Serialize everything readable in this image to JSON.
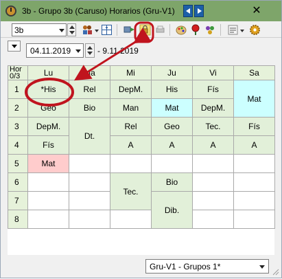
{
  "window": {
    "title": "3b - Grupo 3b (Caruso)  Horarios  (Gru-V1)",
    "close_glyph": "✕"
  },
  "toolbar": {
    "class_value": "3b",
    "icons": [
      "teachers-icon",
      "grid-icon",
      "transfer-icon",
      "lock-icon",
      "print-icon",
      "paint-icon",
      "pin-icon",
      "people-icon",
      "settings-icon",
      "gear-icon"
    ]
  },
  "datebar": {
    "start_date": "04.11.2019",
    "end_date": "- 9.11.2019"
  },
  "timetable": {
    "corner_top": "Hor",
    "corner_bottom": "0/3",
    "days": [
      "Lu",
      "Ma",
      "Mi",
      "Ju",
      "Vi",
      "Sa"
    ],
    "hours": [
      "1",
      "2",
      "3",
      "4",
      "5",
      "6",
      "7",
      "8"
    ],
    "lessons": {
      "lu1": "*His",
      "lu2": "Geo",
      "lu3": "DepM.",
      "lu4": "Fís",
      "lu5": "Mat",
      "ma1": "Rel",
      "ma2": "Bio",
      "ma34": "Dt.",
      "mi1": "DepM.",
      "mi2": "Man",
      "mi3": "Rel",
      "mi4": "A",
      "mi67": "Tec.",
      "ju1": "His",
      "ju2": "Mat",
      "ju3": "Geo",
      "ju4": "A",
      "ju6": "Bio",
      "ju78": "Dib.",
      "vi1": "Fís",
      "vi2": "DepM.",
      "vi3": "Tec.",
      "vi4": "A",
      "sa12": "Mat",
      "sa3": "Fís",
      "sa4": "A"
    }
  },
  "status": {
    "group_value": "Gru-V1 - Grupos 1*"
  },
  "colors": {
    "titlebar": "#7ea56a",
    "lesson_green": "#e2f0d9",
    "lesson_cyan": "#ccffff",
    "lesson_pink": "#ffcccc",
    "annotation_red": "#c0141e"
  }
}
